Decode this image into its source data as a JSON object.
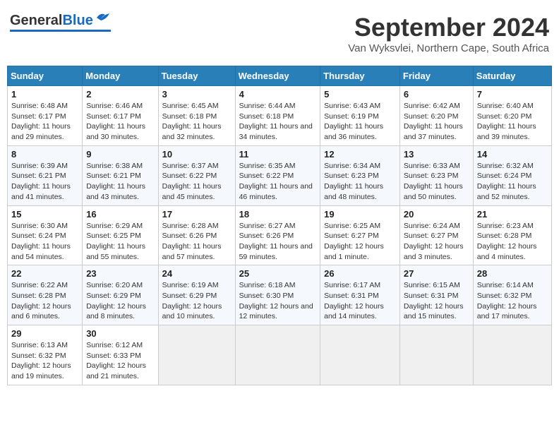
{
  "header": {
    "logo_general": "General",
    "logo_blue": "Blue",
    "title": "September 2024",
    "subtitle": "Van Wyksvlei, Northern Cape, South Africa"
  },
  "columns": [
    "Sunday",
    "Monday",
    "Tuesday",
    "Wednesday",
    "Thursday",
    "Friday",
    "Saturday"
  ],
  "weeks": [
    [
      {
        "day": "1",
        "sunrise": "Sunrise: 6:48 AM",
        "sunset": "Sunset: 6:17 PM",
        "daylight": "Daylight: 11 hours and 29 minutes."
      },
      {
        "day": "2",
        "sunrise": "Sunrise: 6:46 AM",
        "sunset": "Sunset: 6:17 PM",
        "daylight": "Daylight: 11 hours and 30 minutes."
      },
      {
        "day": "3",
        "sunrise": "Sunrise: 6:45 AM",
        "sunset": "Sunset: 6:18 PM",
        "daylight": "Daylight: 11 hours and 32 minutes."
      },
      {
        "day": "4",
        "sunrise": "Sunrise: 6:44 AM",
        "sunset": "Sunset: 6:18 PM",
        "daylight": "Daylight: 11 hours and 34 minutes."
      },
      {
        "day": "5",
        "sunrise": "Sunrise: 6:43 AM",
        "sunset": "Sunset: 6:19 PM",
        "daylight": "Daylight: 11 hours and 36 minutes."
      },
      {
        "day": "6",
        "sunrise": "Sunrise: 6:42 AM",
        "sunset": "Sunset: 6:20 PM",
        "daylight": "Daylight: 11 hours and 37 minutes."
      },
      {
        "day": "7",
        "sunrise": "Sunrise: 6:40 AM",
        "sunset": "Sunset: 6:20 PM",
        "daylight": "Daylight: 11 hours and 39 minutes."
      }
    ],
    [
      {
        "day": "8",
        "sunrise": "Sunrise: 6:39 AM",
        "sunset": "Sunset: 6:21 PM",
        "daylight": "Daylight: 11 hours and 41 minutes."
      },
      {
        "day": "9",
        "sunrise": "Sunrise: 6:38 AM",
        "sunset": "Sunset: 6:21 PM",
        "daylight": "Daylight: 11 hours and 43 minutes."
      },
      {
        "day": "10",
        "sunrise": "Sunrise: 6:37 AM",
        "sunset": "Sunset: 6:22 PM",
        "daylight": "Daylight: 11 hours and 45 minutes."
      },
      {
        "day": "11",
        "sunrise": "Sunrise: 6:35 AM",
        "sunset": "Sunset: 6:22 PM",
        "daylight": "Daylight: 11 hours and 46 minutes."
      },
      {
        "day": "12",
        "sunrise": "Sunrise: 6:34 AM",
        "sunset": "Sunset: 6:23 PM",
        "daylight": "Daylight: 11 hours and 48 minutes."
      },
      {
        "day": "13",
        "sunrise": "Sunrise: 6:33 AM",
        "sunset": "Sunset: 6:23 PM",
        "daylight": "Daylight: 11 hours and 50 minutes."
      },
      {
        "day": "14",
        "sunrise": "Sunrise: 6:32 AM",
        "sunset": "Sunset: 6:24 PM",
        "daylight": "Daylight: 11 hours and 52 minutes."
      }
    ],
    [
      {
        "day": "15",
        "sunrise": "Sunrise: 6:30 AM",
        "sunset": "Sunset: 6:24 PM",
        "daylight": "Daylight: 11 hours and 54 minutes."
      },
      {
        "day": "16",
        "sunrise": "Sunrise: 6:29 AM",
        "sunset": "Sunset: 6:25 PM",
        "daylight": "Daylight: 11 hours and 55 minutes."
      },
      {
        "day": "17",
        "sunrise": "Sunrise: 6:28 AM",
        "sunset": "Sunset: 6:26 PM",
        "daylight": "Daylight: 11 hours and 57 minutes."
      },
      {
        "day": "18",
        "sunrise": "Sunrise: 6:27 AM",
        "sunset": "Sunset: 6:26 PM",
        "daylight": "Daylight: 11 hours and 59 minutes."
      },
      {
        "day": "19",
        "sunrise": "Sunrise: 6:25 AM",
        "sunset": "Sunset: 6:27 PM",
        "daylight": "Daylight: 12 hours and 1 minute."
      },
      {
        "day": "20",
        "sunrise": "Sunrise: 6:24 AM",
        "sunset": "Sunset: 6:27 PM",
        "daylight": "Daylight: 12 hours and 3 minutes."
      },
      {
        "day": "21",
        "sunrise": "Sunrise: 6:23 AM",
        "sunset": "Sunset: 6:28 PM",
        "daylight": "Daylight: 12 hours and 4 minutes."
      }
    ],
    [
      {
        "day": "22",
        "sunrise": "Sunrise: 6:22 AM",
        "sunset": "Sunset: 6:28 PM",
        "daylight": "Daylight: 12 hours and 6 minutes."
      },
      {
        "day": "23",
        "sunrise": "Sunrise: 6:20 AM",
        "sunset": "Sunset: 6:29 PM",
        "daylight": "Daylight: 12 hours and 8 minutes."
      },
      {
        "day": "24",
        "sunrise": "Sunrise: 6:19 AM",
        "sunset": "Sunset: 6:29 PM",
        "daylight": "Daylight: 12 hours and 10 minutes."
      },
      {
        "day": "25",
        "sunrise": "Sunrise: 6:18 AM",
        "sunset": "Sunset: 6:30 PM",
        "daylight": "Daylight: 12 hours and 12 minutes."
      },
      {
        "day": "26",
        "sunrise": "Sunrise: 6:17 AM",
        "sunset": "Sunset: 6:31 PM",
        "daylight": "Daylight: 12 hours and 14 minutes."
      },
      {
        "day": "27",
        "sunrise": "Sunrise: 6:15 AM",
        "sunset": "Sunset: 6:31 PM",
        "daylight": "Daylight: 12 hours and 15 minutes."
      },
      {
        "day": "28",
        "sunrise": "Sunrise: 6:14 AM",
        "sunset": "Sunset: 6:32 PM",
        "daylight": "Daylight: 12 hours and 17 minutes."
      }
    ],
    [
      {
        "day": "29",
        "sunrise": "Sunrise: 6:13 AM",
        "sunset": "Sunset: 6:32 PM",
        "daylight": "Daylight: 12 hours and 19 minutes."
      },
      {
        "day": "30",
        "sunrise": "Sunrise: 6:12 AM",
        "sunset": "Sunset: 6:33 PM",
        "daylight": "Daylight: 12 hours and 21 minutes."
      },
      null,
      null,
      null,
      null,
      null
    ]
  ]
}
